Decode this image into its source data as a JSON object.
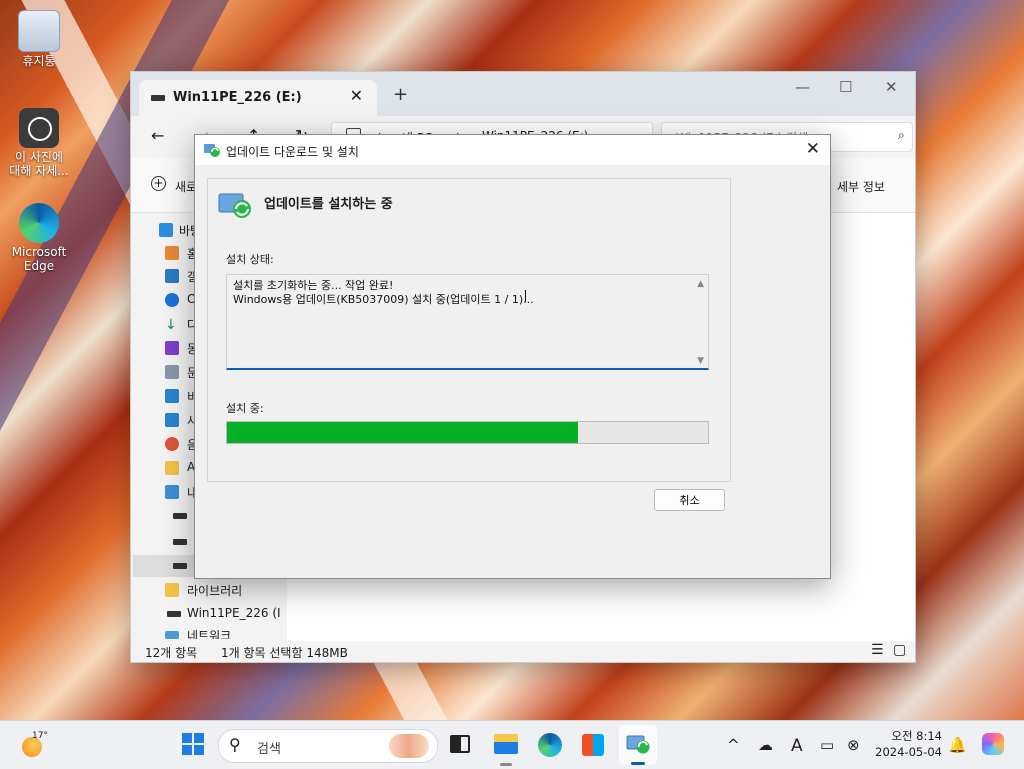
{
  "desktop": {
    "icons": [
      {
        "label": "휴지통"
      },
      {
        "label": "이 사진에\n대해 자세..."
      },
      {
        "label": "Microsoft\nEdge"
      }
    ]
  },
  "explorer": {
    "tab_title": "Win11PE_226 (E:)",
    "breadcrumb": [
      "내 PC",
      "Win11PE_226 (E:)"
    ],
    "search_placeholder": "Win11PE_226 (E:) 검색",
    "new_label": "새로",
    "details_label": "세부 정보",
    "sidebar": [
      "바탕",
      "홈",
      "갤",
      "O",
      "다",
      "동",
      "문",
      "비",
      "사",
      "음",
      "A",
      "내",
      "",
      "",
      "",
      "라이브러리",
      "Win11PE_226 (I",
      "네트워크"
    ],
    "status_items": "12개 항목",
    "status_selected": "1개 항목 선택함 148MB"
  },
  "dialog": {
    "title": "업데이트 다운로드 및 설치",
    "heading": "업데이트를 설치하는 중",
    "status_label": "설치 상태:",
    "log_lines": [
      "설치를 초기화하는 중... 작업 완료!",
      "Windows용 업데이트(KB5037009) 설치 중(업데이트 1 / 1)..."
    ],
    "progress_label": "설치 중:",
    "progress": 0.73,
    "cancel_label": "취소"
  },
  "taskbar": {
    "weather_temp": "17°",
    "search_placeholder": "검색",
    "clock_time": "오전 8:14",
    "clock_date": "2024-05-04",
    "colors": {
      "accent": "#0a5fb4",
      "progress": "#06b025"
    }
  }
}
